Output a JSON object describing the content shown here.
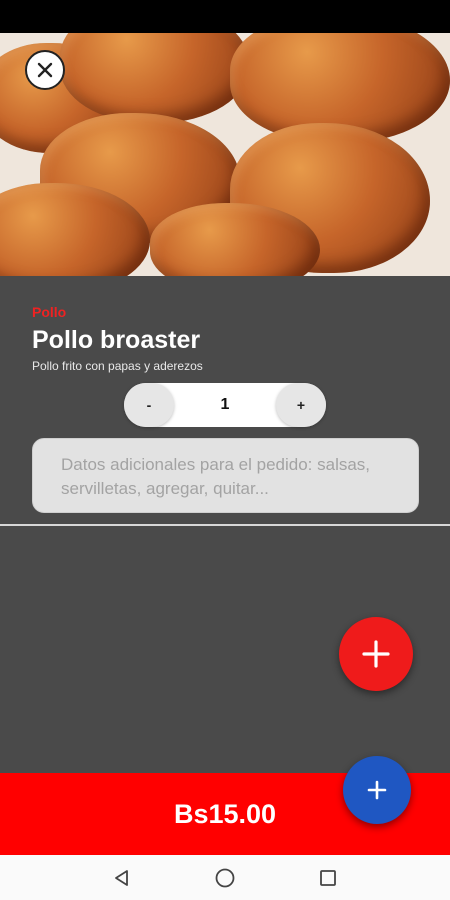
{
  "product": {
    "category": "Pollo",
    "name": "Pollo broaster",
    "description": "Pollo frito con papas y aderezos",
    "price": "Bs15.00"
  },
  "quantity": {
    "minus_label": "-",
    "value": "1",
    "plus_label": "+"
  },
  "notes": {
    "placeholder": "Datos adicionales para el pedido: salsas, servilletas, agregar, quitar..."
  },
  "icons": {
    "close": "close-icon",
    "add_fab": "plus-icon",
    "cart_fab": "plus-icon",
    "nav_back": "back-triangle-icon",
    "nav_home": "home-circle-icon",
    "nav_recents": "recents-square-icon"
  },
  "colors": {
    "accent_red": "#ff0000",
    "fab_blue": "#1f57c2",
    "background": "#4a4a4a"
  }
}
